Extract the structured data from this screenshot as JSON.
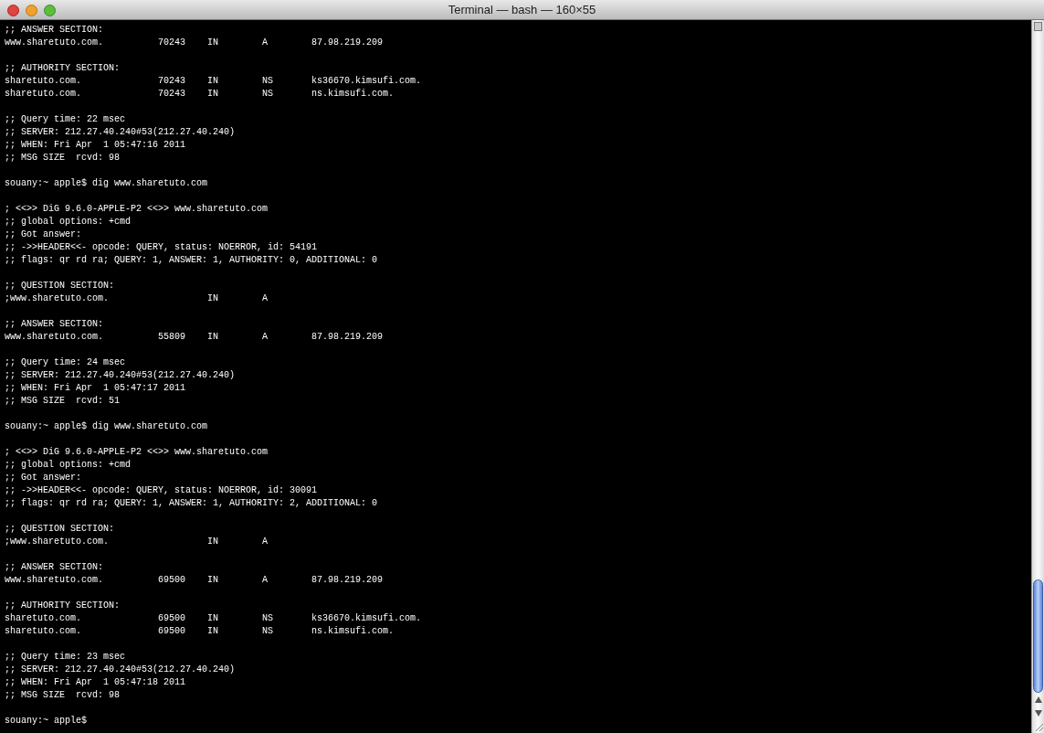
{
  "window": {
    "title": "Terminal — bash — 160×55"
  },
  "terminal": {
    "blocks": [
      [
        ";; ANSWER SECTION:",
        "www.sharetuto.com.          70243    IN        A        87.98.219.209"
      ],
      [
        ";; AUTHORITY SECTION:",
        "sharetuto.com.              70243    IN        NS       ks36670.kimsufi.com.",
        "sharetuto.com.              70243    IN        NS       ns.kimsufi.com."
      ],
      [
        ";; Query time: 22 msec",
        ";; SERVER: 212.27.40.240#53(212.27.40.240)",
        ";; WHEN: Fri Apr  1 05:47:16 2011",
        ";; MSG SIZE  rcvd: 98"
      ],
      [
        "souany:~ apple$ dig www.sharetuto.com"
      ],
      [
        "; <<>> DiG 9.6.0-APPLE-P2 <<>> www.sharetuto.com",
        ";; global options: +cmd",
        ";; Got answer:",
        ";; ->>HEADER<<- opcode: QUERY, status: NOERROR, id: 54191",
        ";; flags: qr rd ra; QUERY: 1, ANSWER: 1, AUTHORITY: 0, ADDITIONAL: 0"
      ],
      [
        ";; QUESTION SECTION:",
        ";www.sharetuto.com.                  IN        A"
      ],
      [
        ";; ANSWER SECTION:",
        "www.sharetuto.com.          55809    IN        A        87.98.219.209"
      ],
      [
        ";; Query time: 24 msec",
        ";; SERVER: 212.27.40.240#53(212.27.40.240)",
        ";; WHEN: Fri Apr  1 05:47:17 2011",
        ";; MSG SIZE  rcvd: 51"
      ],
      [
        "souany:~ apple$ dig www.sharetuto.com"
      ],
      [
        "; <<>> DiG 9.6.0-APPLE-P2 <<>> www.sharetuto.com",
        ";; global options: +cmd",
        ";; Got answer:",
        ";; ->>HEADER<<- opcode: QUERY, status: NOERROR, id: 30091",
        ";; flags: qr rd ra; QUERY: 1, ANSWER: 1, AUTHORITY: 2, ADDITIONAL: 0"
      ],
      [
        ";; QUESTION SECTION:",
        ";www.sharetuto.com.                  IN        A"
      ],
      [
        ";; ANSWER SECTION:",
        "www.sharetuto.com.          69500    IN        A        87.98.219.209"
      ],
      [
        ";; AUTHORITY SECTION:",
        "sharetuto.com.              69500    IN        NS       ks36670.kimsufi.com.",
        "sharetuto.com.              69500    IN        NS       ns.kimsufi.com."
      ],
      [
        ";; Query time: 23 msec",
        ";; SERVER: 212.27.40.240#53(212.27.40.240)",
        ";; WHEN: Fri Apr  1 05:47:18 2011",
        ";; MSG SIZE  rcvd: 98"
      ],
      [
        "souany:~ apple$"
      ]
    ]
  }
}
